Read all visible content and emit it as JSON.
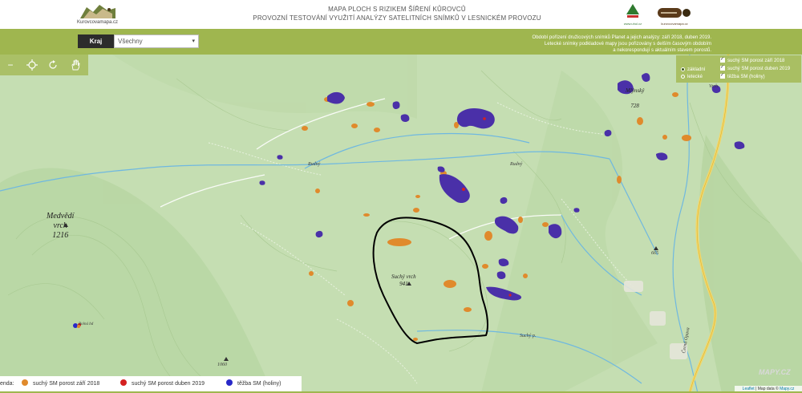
{
  "header": {
    "logo_left_text": "Kurovcovamapa.cz",
    "title_line1": "MAPA PLOCH S RIZIKEM ŠÍŘENÍ KŮROVCŮ",
    "title_line2": "PROVOZNÍ TESTOVÁNÍ VYUŽITÍ ANALÝZY SATELITNÍCH SNÍMKŮ V LESNICKÉM PROVOZU",
    "logo_r1_text": "www.uhul.cz",
    "logo_r2_text": "kurovcovamapa.cz"
  },
  "toolbar": {
    "kraj_label": "Kraj",
    "kraj_value": "Všechny",
    "info_line1": "Období pořízení družicových snímků Planet a jejich analýzy: září 2018, duben 2019.",
    "info_line2": "Letecké snímky podkladové mapy jsou pořizovány s delším časovým obdobím",
    "info_line3": "a nekorespondují s aktuálním stavem porostů."
  },
  "map_tools": {
    "zoom_out": "−",
    "locate_icon": "crosshair-icon",
    "history_icon": "refresh-icon",
    "pan_icon": "hand-icon"
  },
  "layers": {
    "base_options": [
      "základní",
      "letecké"
    ],
    "base_selected": "základní",
    "overlays": [
      "suchý SM porost září 2018",
      "suchý SM porost duben 2019",
      "těžba SM (holiny)"
    ]
  },
  "map_labels": {
    "medvedi": [
      "Medvědí",
      "vrch",
      "1216"
    ],
    "suchy": [
      "Suchý vrch",
      "941"
    ],
    "mlynsky": [
      "Mlýnský",
      "728"
    ],
    "elev_665": "665",
    "elev_1060": "1060",
    "stream_rudny1": "Rudný",
    "stream_rudny2": "Rudný",
    "stream_suchy": "Suchý p.",
    "hut": "Bolná bd",
    "vrch": "Vrch",
    "valley": "Černá Opava"
  },
  "legend": {
    "prefix": "enda:",
    "items": [
      {
        "label": "suchý SM porost září 2018",
        "color": "#e08a2c"
      },
      {
        "label": "suchý SM porost duben 2019",
        "color": "#d42020"
      },
      {
        "label": "těžba SM (holiny)",
        "color": "#2828c8"
      }
    ]
  },
  "attribution": {
    "mapy_logo": "MAPY.CZ",
    "leaflet": "Leaflet",
    "sep": " | Map data © ",
    "mapycz": "Mapy.cz"
  },
  "colors": {
    "toolbar": "#9fb64f",
    "map_bg": "#c5deb2",
    "dry_2018": "#e08a2c",
    "dry_2019": "#d42020",
    "clearcut": "#2828c8"
  }
}
